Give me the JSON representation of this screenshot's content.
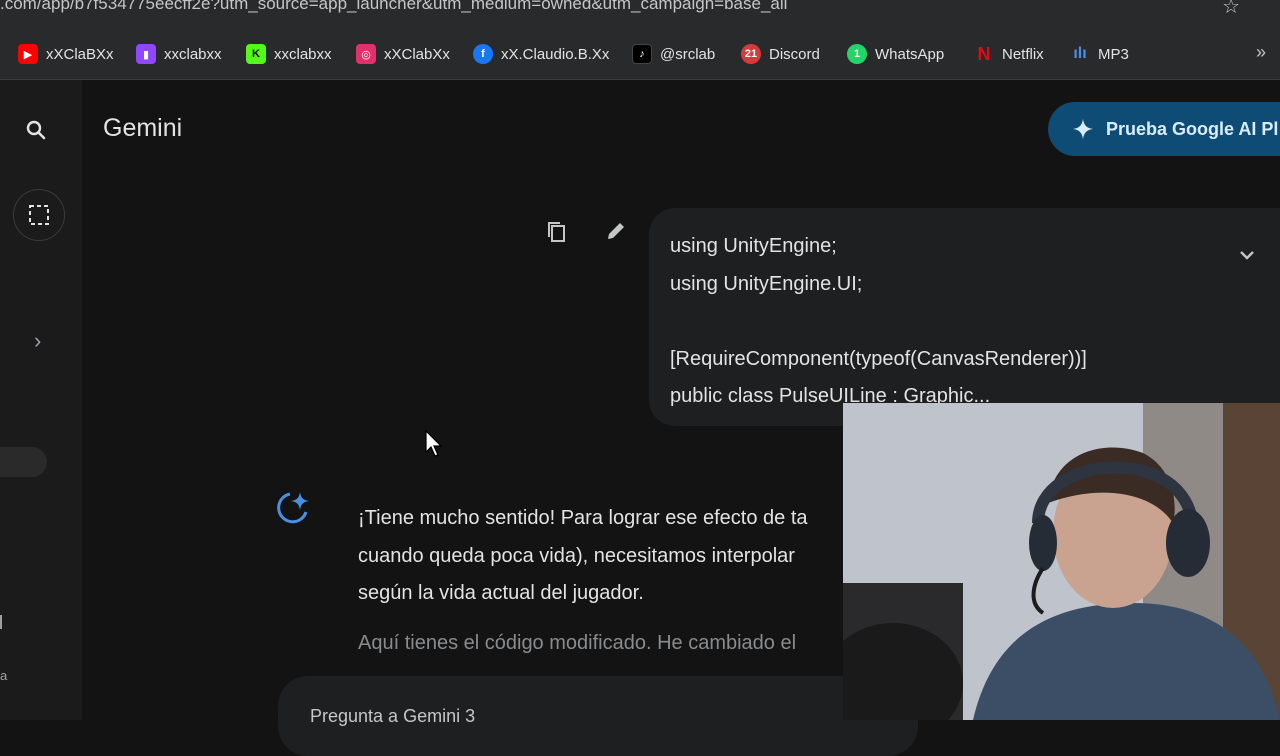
{
  "browser": {
    "url_text": ".com/app/b7f534775eecff2e?utm_source=app_launcher&utm_medium=owned&utm_campaign=base_all",
    "bookmark_icon": "star-icon",
    "bookmarks": [
      {
        "label": "xXClaBXx",
        "icon": "youtube-icon",
        "color": "#ff0000"
      },
      {
        "label": "xxclabxx",
        "icon": "twitch-icon",
        "color": "#9146ff"
      },
      {
        "label": "xxclabxx",
        "icon": "kick-icon",
        "color": "#53fc18"
      },
      {
        "label": "xXClabXx",
        "icon": "instagram-icon",
        "color": "#e1306c"
      },
      {
        "label": "xX.Claudio.B.Xx",
        "icon": "facebook-icon",
        "color": "#1877f2"
      },
      {
        "label": "@srclab",
        "icon": "tiktok-icon",
        "color": "#000000"
      },
      {
        "label": "Discord",
        "icon": "discord-icon",
        "color": "#5865f2"
      },
      {
        "label": "WhatsApp",
        "icon": "whatsapp-icon",
        "color": "#25d366"
      },
      {
        "label": "Netflix",
        "icon": "netflix-icon",
        "color": "#e50914"
      },
      {
        "label": "MP3",
        "icon": "chart-icon",
        "color": "#4a90e2"
      }
    ],
    "more": "»"
  },
  "app": {
    "title": "Gemini",
    "upgrade_label": "Prueba Google AI Pl",
    "accent": "#0e4b75"
  },
  "user_message": {
    "lines": [
      "using UnityEngine;",
      "using UnityEngine.UI;",
      "",
      "[RequireComponent(typeof(CanvasRenderer))]",
      "public class PulseUILine : Graphic..."
    ]
  },
  "reply": {
    "line1": "¡Tiene mucho sentido! Para lograr ese efecto de ta",
    "line2": "cuando queda poca vida), necesitamos interpolar",
    "line3": "según la vida actual del jugador.",
    "line4": "Aquí tienes el código modificado. He cambiado el"
  },
  "composer": {
    "placeholder": "Pregunta a Gemini 3"
  }
}
